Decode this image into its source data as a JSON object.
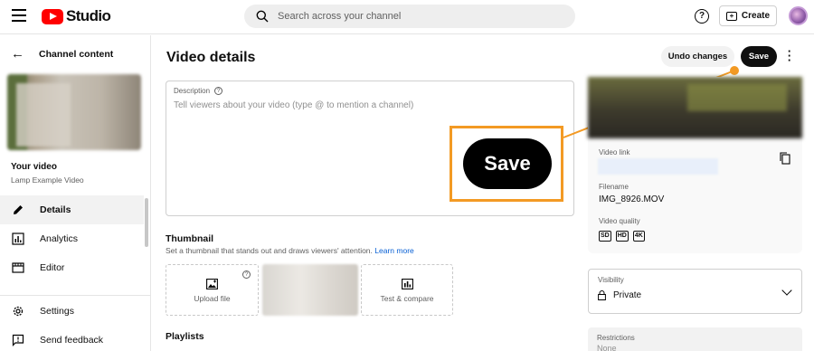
{
  "topbar": {
    "logo_text": "Studio",
    "search_placeholder": "Search across your channel",
    "help_label": "?",
    "create_label": "Create"
  },
  "sidebar": {
    "back_label": "Channel content",
    "your_video_label": "Your video",
    "video_name": "Lamp Example Video",
    "items": [
      {
        "label": "Details",
        "icon": "pencil-icon",
        "active": true
      },
      {
        "label": "Analytics",
        "icon": "analytics-icon",
        "active": false
      },
      {
        "label": "Editor",
        "icon": "editor-icon",
        "active": false
      },
      {
        "label": "Settings",
        "icon": "gear-icon",
        "active": false
      },
      {
        "label": "Send feedback",
        "icon": "feedback-icon",
        "active": false
      }
    ]
  },
  "header": {
    "title": "Video details",
    "undo_label": "Undo changes",
    "save_label": "Save",
    "more_label": "⋮"
  },
  "description": {
    "label": "Description",
    "placeholder": "Tell viewers about your video (type @ to mention a channel)"
  },
  "callout": {
    "label": "Save",
    "accent_color": "#f39a24"
  },
  "thumbnail": {
    "title": "Thumbnail",
    "subtitle": "Set a thumbnail that stands out and draws viewers' attention.",
    "learn_more": "Learn more",
    "upload_label": "Upload file",
    "test_label": "Test & compare"
  },
  "playlists": {
    "title": "Playlists"
  },
  "right_panel": {
    "video_link_label": "Video link",
    "filename_label": "Filename",
    "filename": "IMG_8926.MOV",
    "quality_label": "Video quality",
    "quality_badges": [
      "SD",
      "HD",
      "4K"
    ]
  },
  "visibility": {
    "label": "Visibility",
    "value": "Private"
  },
  "restrictions": {
    "label": "Restrictions",
    "value": "None"
  }
}
